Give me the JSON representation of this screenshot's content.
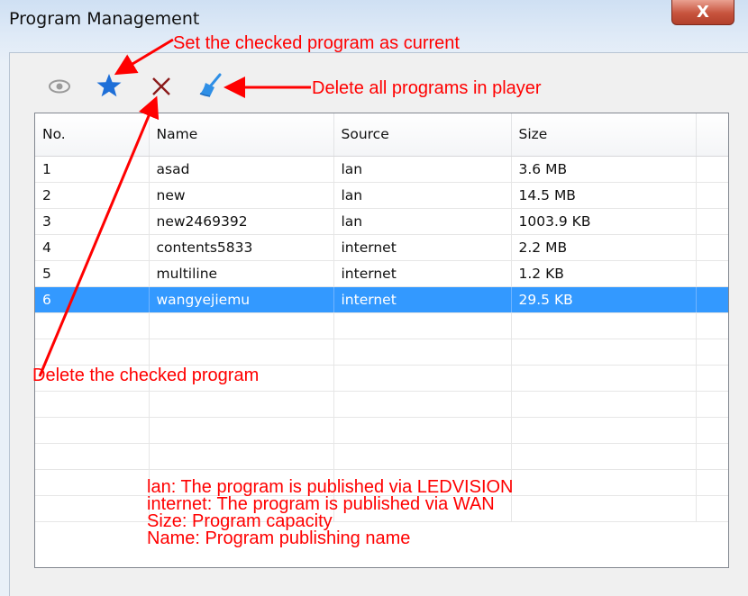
{
  "window": {
    "title": "Program Management",
    "close_label": "X"
  },
  "toolbar": {
    "items": [
      {
        "name": "preview",
        "icon": "eye-icon",
        "color": "#9a9a9a"
      },
      {
        "name": "set-current",
        "icon": "star-icon",
        "color": "#1e6fd8"
      },
      {
        "name": "delete",
        "icon": "close-icon",
        "color": "#8b1a1a"
      },
      {
        "name": "clear-all",
        "icon": "broom-icon",
        "color": "#2f8fe6"
      }
    ]
  },
  "table": {
    "columns": [
      "No.",
      "Name",
      "Source",
      "Size"
    ],
    "rows": [
      {
        "no": "1",
        "name": "asad",
        "source": "lan",
        "size": "3.6 MB"
      },
      {
        "no": "2",
        "name": "new",
        "source": "lan",
        "size": "14.5 MB"
      },
      {
        "no": "3",
        "name": "new2469392",
        "source": "lan",
        "size": "1003.9 KB"
      },
      {
        "no": "4",
        "name": "contents5833",
        "source": "internet",
        "size": "2.2 MB"
      },
      {
        "no": "5",
        "name": "multiline",
        "source": "internet",
        "size": "1.2 KB"
      },
      {
        "no": "6",
        "name": "wangyejiemu",
        "source": "internet",
        "size": "29.5 KB"
      }
    ],
    "selected_row": "6",
    "selection_color": "#3399ff"
  },
  "annotations": {
    "set_current": "Set the checked program as current",
    "delete_all": "Delete all programs in player",
    "delete_checked": "Delete the checked program",
    "color": "#ff0000"
  },
  "legend": {
    "lan": "lan: The program is published via LEDVISION",
    "internet": "internet: The program is published via  WAN",
    "size": "Size: Program capacity",
    "name": "Name: Program publishing name"
  }
}
